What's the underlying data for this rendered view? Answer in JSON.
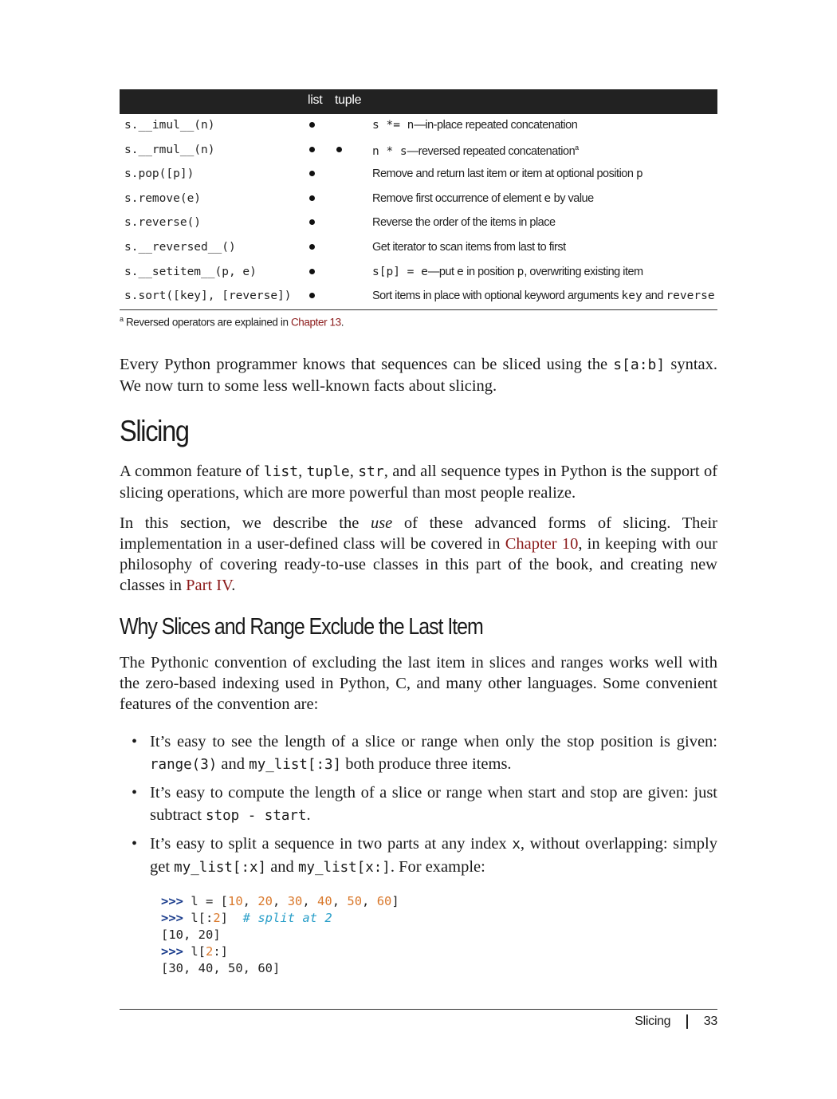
{
  "table": {
    "headers": {
      "col2": "list",
      "col3": "tuple"
    },
    "rows": [
      {
        "method": "s.__imul__(n)",
        "list": true,
        "tuple": false,
        "desc_code": "s *= n",
        "desc_text": "—in-place repeated concatenation",
        "desc_sup": ""
      },
      {
        "method": "s.__rmul__(n)",
        "list": true,
        "tuple": true,
        "desc_code": "n * s",
        "desc_text": "—reversed repeated concatenation",
        "desc_sup": "a"
      },
      {
        "method": "s.pop([p])",
        "list": true,
        "tuple": false,
        "desc_pre": "Remove and return last item or item at optional position ",
        "desc_code2": "p"
      },
      {
        "method": "s.remove(e)",
        "list": true,
        "tuple": false,
        "desc_pre": "Remove first occurrence of element ",
        "desc_code2": "e",
        "desc_post": " by value"
      },
      {
        "method": "s.reverse()",
        "list": true,
        "tuple": false,
        "desc_pre": "Reverse the order of the items in place"
      },
      {
        "method": "s.__reversed__()",
        "list": true,
        "tuple": false,
        "desc_pre": "Get iterator to scan items from last to first"
      },
      {
        "method": "s.__setitem__(p, e)",
        "list": true,
        "tuple": false,
        "desc_code": "s[p] = e",
        "desc_text": "—put ",
        "desc_code2": "e",
        "desc_mid": " in position ",
        "desc_code3": "p",
        "desc_post": ", overwriting existing item"
      },
      {
        "method": "s.sort([key], [reverse])",
        "list": true,
        "tuple": false,
        "desc_pre": "Sort items in place with optional keyword arguments ",
        "desc_code2": "key",
        "desc_mid": " and ",
        "desc_code3": "reverse"
      }
    ],
    "footnote": {
      "marker": "a",
      "text": " Reversed operators are explained in ",
      "link": "Chapter 13",
      "end": "."
    }
  },
  "intro": {
    "text1": "Every Python programmer knows that sequences can be sliced using the ",
    "code1": "s[a:b]",
    "text2": " syntax. We now turn to some less well-known facts about slicing."
  },
  "section": {
    "title": "Slicing",
    "p1": {
      "a": "A common feature of ",
      "c1": "list",
      "b": ", ",
      "c2": "tuple",
      "c": ", ",
      "c3": "str",
      "d": ", and all sequence types in Python is the support of slicing operations, which are more powerful than most people realize."
    },
    "p2": {
      "a": "In this section, we describe the ",
      "em": "use",
      "b": " of these advanced forms of slicing. Their implementation in a user-defined class will be covered in ",
      "link1": "Chapter 10",
      "c": ", in keeping with our philosophy of covering ready-to-use classes in this part of the book, and creating new classes in ",
      "link2": "Part IV",
      "d": "."
    }
  },
  "subsection": {
    "title": "Why Slices and Range Exclude the Last Item",
    "p1": "The Pythonic convention of excluding the last item in slices and ranges works well with the zero-based indexing used in Python, C, and many other languages. Some convenient features of the convention are:",
    "bullets": [
      {
        "a": "It’s easy to see the length of a slice or range when only the stop position is given: ",
        "c1": "range(3)",
        "b": " and ",
        "c2": "my_list[:3]",
        "c": " both produce three items."
      },
      {
        "a": "It’s easy to compute the length of a slice or range when start and stop are given: just subtract ",
        "c1": "stop - start",
        "b": "."
      },
      {
        "a": "It’s easy to split a sequence in two parts at any index ",
        "c1": "x",
        "b": ", without overlapping: simply get ",
        "c2": "my_list[:x]",
        "c": " and ",
        "c3": "my_list[x:]",
        "d": ". For example:"
      }
    ]
  },
  "code": {
    "line1": {
      "prompt": ">>>",
      "pre": " l = [",
      "n1": "10",
      "n2": "20",
      "n3": "30",
      "n4": "40",
      "n5": "50",
      "n6": "60",
      "post": "]"
    },
    "line2": {
      "prompt": ">>>",
      "pre": " l[:",
      "n": "2",
      "post": "]  ",
      "comment": "# split at 2"
    },
    "line3": "[10, 20]",
    "line4": {
      "prompt": ">>>",
      "pre": " l[",
      "n": "2",
      "post": ":]"
    },
    "line5": "[30, 40, 50, 60]"
  },
  "footer": {
    "section": "Slicing",
    "page": "33"
  }
}
